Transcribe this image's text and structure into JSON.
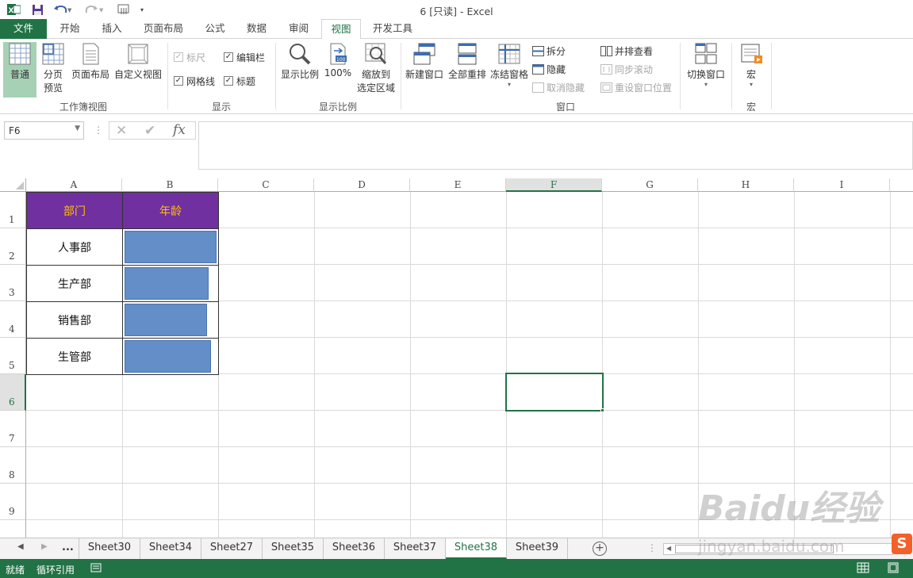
{
  "window": {
    "title": "6  [只读] - Excel",
    "app_icon": "excel-logo-icon",
    "qat": [
      "save-icon",
      "undo-icon",
      "redo-icon",
      "touch-mode-icon",
      "customize-qat-icon"
    ]
  },
  "tabs": [
    {
      "label": "文件"
    },
    {
      "label": "开始"
    },
    {
      "label": "插入"
    },
    {
      "label": "页面布局"
    },
    {
      "label": "公式"
    },
    {
      "label": "数据"
    },
    {
      "label": "审阅"
    },
    {
      "label": "视图"
    },
    {
      "label": "开发工具"
    }
  ],
  "active_tab": "视图",
  "ribbon": {
    "workbook_views": {
      "label": "工作簿视图",
      "normal": "普通",
      "page_break": [
        "分页",
        "预览"
      ],
      "page_layout": "页面布局",
      "custom_views": "自定义视图"
    },
    "show": {
      "label": "显示",
      "ruler": "标尺",
      "formula_bar": "编辑栏",
      "gridlines": "网格线",
      "headings": "标题"
    },
    "zoom": {
      "label": "显示比例",
      "zoom": "显示比例",
      "zoom100": "100%",
      "zoom_sel": [
        "缩放到",
        "选定区域"
      ]
    },
    "window": {
      "label": "窗口",
      "new_window": "新建窗口",
      "arrange_all": "全部重排",
      "freeze_panes": "冻结窗格",
      "split": "拆分",
      "hide": "隐藏",
      "unhide": "取消隐藏",
      "side_by_side": "并排查看",
      "sync_scroll": "同步滚动",
      "reset_position": "重设窗口位置",
      "switch_windows": "切换窗口"
    },
    "macros": {
      "label": "宏",
      "macros": "宏"
    }
  },
  "formula_bar": {
    "name_box": "F6",
    "formula": ""
  },
  "columns": [
    "A",
    "B",
    "C",
    "D",
    "E",
    "F",
    "G",
    "H",
    "I"
  ],
  "rows": [
    "1",
    "2",
    "3",
    "4",
    "5",
    "6",
    "7",
    "8",
    "9"
  ],
  "selected_cell": "F6",
  "table": {
    "header_fill": "#7030a0",
    "header_text_color": "#ffc000",
    "bar_color": "#648ec7",
    "headers": [
      "部门",
      "年龄"
    ],
    "rows": [
      {
        "dept": "人事部",
        "bar_fill": 1.0
      },
      {
        "dept": "生产部",
        "bar_fill": 0.91
      },
      {
        "dept": "销售部",
        "bar_fill": 0.9
      },
      {
        "dept": "生管部",
        "bar_fill": 0.94
      }
    ]
  },
  "sheet_tabs": {
    "ellipsis": "...",
    "names": [
      "Sheet30",
      "Sheet34",
      "Sheet27",
      "Sheet35",
      "Sheet36",
      "Sheet37",
      "Sheet38",
      "Sheet39"
    ],
    "active": "Sheet38"
  },
  "status": {
    "ready": "就绪",
    "circular": "循环引用"
  },
  "watermark": {
    "brand": "Baidu经验",
    "url": "jingyan.baidu.com"
  }
}
